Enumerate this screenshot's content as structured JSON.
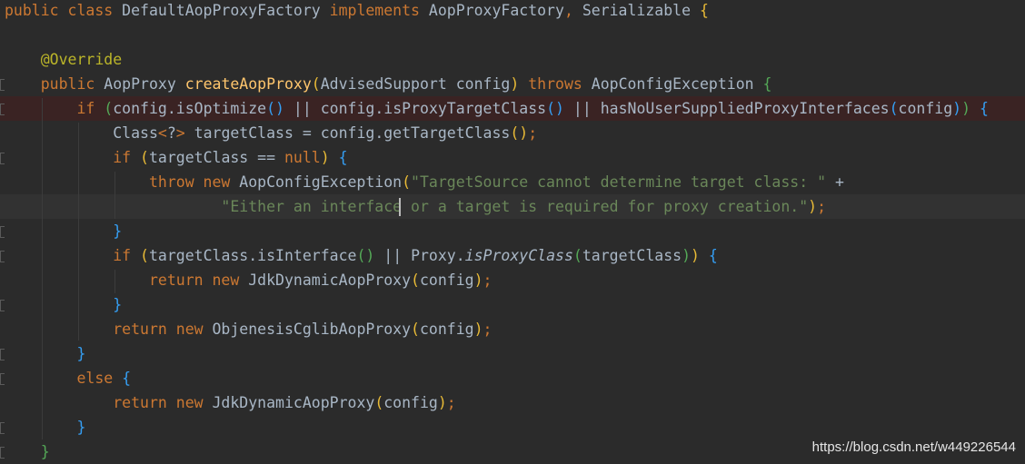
{
  "editor": {
    "lines": [
      {
        "tokens": [
          [
            "kw",
            "public "
          ],
          [
            "kw",
            "class "
          ],
          [
            "id",
            "DefaultAopProxyFactory "
          ],
          [
            "kw",
            "implements "
          ],
          [
            "id",
            "AopProxyFactory"
          ],
          [
            "kw",
            ", "
          ],
          [
            "id",
            "Serializable "
          ],
          [
            "p1",
            "{"
          ]
        ]
      },
      {
        "tokens": []
      },
      {
        "tokens": [
          [
            "id",
            "    "
          ],
          [
            "an",
            "@Override"
          ]
        ]
      },
      {
        "tokens": [
          [
            "id",
            "    "
          ],
          [
            "kw",
            "public "
          ],
          [
            "id",
            "AopProxy "
          ],
          [
            "fn",
            "createAopProxy"
          ],
          [
            "p1",
            "("
          ],
          [
            "id",
            "AdvisedSupport config"
          ],
          [
            "p1",
            ")"
          ],
          [
            "id",
            " "
          ],
          [
            "kw",
            "throws "
          ],
          [
            "id",
            "AopConfigException "
          ],
          [
            "p2",
            "{"
          ]
        ]
      },
      {
        "tokens": [
          [
            "id",
            "        "
          ],
          [
            "kw",
            "if "
          ],
          [
            "p2",
            "("
          ],
          [
            "id",
            "config.isOptimize"
          ],
          [
            "p3",
            "()"
          ],
          [
            "id",
            " || config.isProxyTargetClass"
          ],
          [
            "p3",
            "()"
          ],
          [
            "id",
            " || hasNoUserSuppliedProxyInterfaces"
          ],
          [
            "p3",
            "("
          ],
          [
            "id",
            "config"
          ],
          [
            "p3",
            ")"
          ],
          [
            "p2",
            ")"
          ],
          [
            "id",
            " "
          ],
          [
            "p3",
            "{"
          ]
        ]
      },
      {
        "tokens": [
          [
            "id",
            "            Class"
          ],
          [
            "kw",
            "<"
          ],
          [
            "id",
            "?"
          ],
          [
            "kw",
            ">"
          ],
          [
            "id",
            " targetClass = config.getTargetClass"
          ],
          [
            "p1",
            "()"
          ],
          [
            "kw",
            ";"
          ]
        ]
      },
      {
        "tokens": [
          [
            "id",
            "            "
          ],
          [
            "kw",
            "if "
          ],
          [
            "p1",
            "("
          ],
          [
            "id",
            "targetClass == "
          ],
          [
            "kw",
            "null"
          ],
          [
            "p1",
            ")"
          ],
          [
            "id",
            " "
          ],
          [
            "p3",
            "{"
          ]
        ]
      },
      {
        "tokens": [
          [
            "id",
            "                "
          ],
          [
            "kw",
            "throw new "
          ],
          [
            "id",
            "AopConfigException"
          ],
          [
            "p1",
            "("
          ],
          [
            "str",
            "\"TargetSource cannot determine target class: \""
          ],
          [
            "id",
            " +"
          ]
        ]
      },
      {
        "tokens": [
          [
            "id",
            "                        "
          ],
          [
            "str",
            "\"Either an interface or a target is required for proxy creation.\""
          ],
          [
            "p1",
            ")"
          ],
          [
            "kw",
            ";"
          ]
        ]
      },
      {
        "tokens": [
          [
            "id",
            "            "
          ],
          [
            "p3",
            "}"
          ]
        ]
      },
      {
        "tokens": [
          [
            "id",
            "            "
          ],
          [
            "kw",
            "if "
          ],
          [
            "p1",
            "("
          ],
          [
            "id",
            "targetClass.isInterface"
          ],
          [
            "p2",
            "()"
          ],
          [
            "id",
            " || Proxy."
          ],
          [
            "it",
            "isProxyClass"
          ],
          [
            "p2",
            "("
          ],
          [
            "id",
            "targetClass"
          ],
          [
            "p2",
            ")"
          ],
          [
            "p1",
            ")"
          ],
          [
            "id",
            " "
          ],
          [
            "p3",
            "{"
          ]
        ]
      },
      {
        "tokens": [
          [
            "id",
            "                "
          ],
          [
            "kw",
            "return new "
          ],
          [
            "id",
            "JdkDynamicAopProxy"
          ],
          [
            "p1",
            "("
          ],
          [
            "id",
            "config"
          ],
          [
            "p1",
            ")"
          ],
          [
            "kw",
            ";"
          ]
        ]
      },
      {
        "tokens": [
          [
            "id",
            "            "
          ],
          [
            "p3",
            "}"
          ]
        ]
      },
      {
        "tokens": [
          [
            "id",
            "            "
          ],
          [
            "kw",
            "return new "
          ],
          [
            "id",
            "ObjenesisCglibAopProxy"
          ],
          [
            "p1",
            "("
          ],
          [
            "id",
            "config"
          ],
          [
            "p1",
            ")"
          ],
          [
            "kw",
            ";"
          ]
        ]
      },
      {
        "tokens": [
          [
            "id",
            "        "
          ],
          [
            "p3",
            "}"
          ]
        ]
      },
      {
        "tokens": [
          [
            "id",
            "        "
          ],
          [
            "kw",
            "else "
          ],
          [
            "p3",
            "{"
          ]
        ]
      },
      {
        "tokens": [
          [
            "id",
            "            "
          ],
          [
            "kw",
            "return new "
          ],
          [
            "id",
            "JdkDynamicAopProxy"
          ],
          [
            "p1",
            "("
          ],
          [
            "id",
            "config"
          ],
          [
            "p1",
            ")"
          ],
          [
            "kw",
            ";"
          ]
        ]
      },
      {
        "tokens": [
          [
            "id",
            "        "
          ],
          [
            "p3",
            "}"
          ]
        ]
      },
      {
        "tokens": [
          [
            "id",
            "    "
          ],
          [
            "p2",
            "}"
          ]
        ]
      }
    ]
  },
  "watermark": "https://blog.csdn.net/w449226544"
}
